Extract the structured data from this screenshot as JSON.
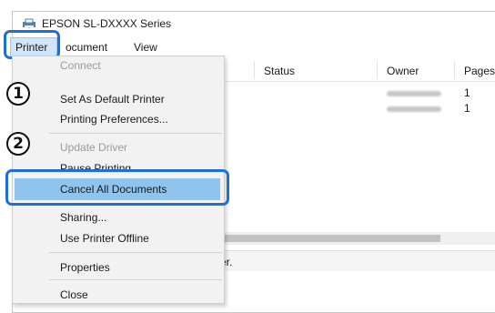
{
  "window": {
    "title": "EPSON SL-DXXXX Series",
    "title_icon": "printer-icon"
  },
  "menubar": {
    "printer": "Printer",
    "document": "ocument",
    "view": "View"
  },
  "table": {
    "columns": [
      "Status",
      "Owner",
      "Pages"
    ],
    "rows": [
      {
        "owner": "(blurred)",
        "pages": "1"
      },
      {
        "owner": "(blurred)",
        "pages": "1"
      }
    ]
  },
  "statusbar": {
    "text": "nter."
  },
  "dropdown": {
    "items": [
      {
        "label": "Connect",
        "enabled": false
      },
      {
        "label": "Set As Default Printer",
        "enabled": true
      },
      {
        "label": "Printing Preferences...",
        "enabled": true
      },
      {
        "label": "Update Driver",
        "enabled": false
      },
      {
        "label": "Pause Printing",
        "enabled": true
      },
      {
        "label": "Cancel All Documents",
        "enabled": true,
        "selected": true
      },
      {
        "label": "Sharing...",
        "enabled": true
      },
      {
        "label": "Use Printer Offline",
        "enabled": true
      },
      {
        "label": "Properties",
        "enabled": true
      },
      {
        "label": "Close",
        "enabled": true
      }
    ]
  },
  "callouts": {
    "one": "1",
    "two": "2"
  },
  "colors": {
    "highlight_border": "#1e6fd9",
    "selected_item": "#8fc4ee",
    "menu_hover": "#cfe6fb"
  }
}
